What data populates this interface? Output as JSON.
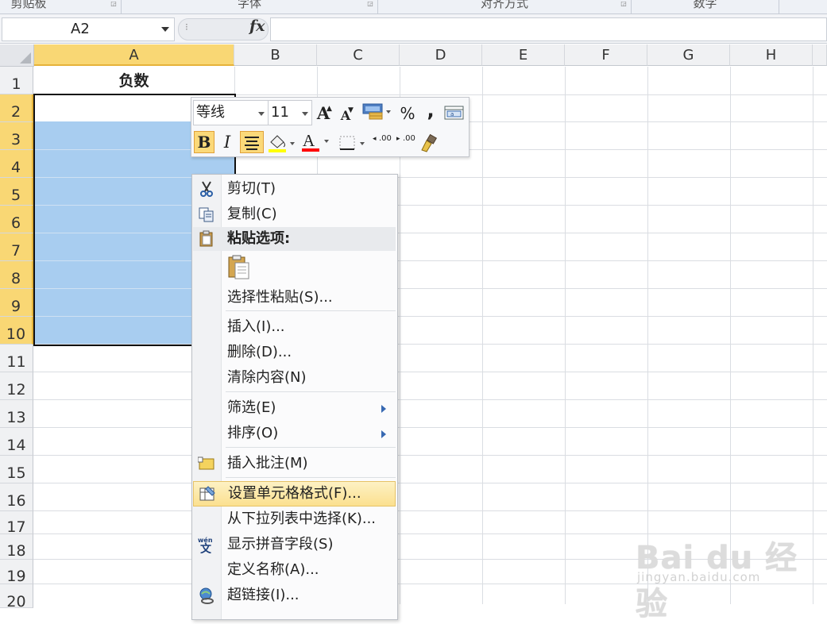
{
  "ribbon": {
    "groups": [
      "剪贴板",
      "字体",
      "对齐方式",
      "数字"
    ]
  },
  "formula_bar": {
    "name_box": "A2",
    "fx_label": "fx",
    "formula": ""
  },
  "grid": {
    "columns": [
      "A",
      "B",
      "C",
      "D",
      "E",
      "F",
      "G",
      "H"
    ],
    "rows": [
      "1",
      "2",
      "3",
      "4",
      "5",
      "6",
      "7",
      "8",
      "9",
      "10",
      "11",
      "12",
      "13",
      "14",
      "15",
      "16",
      "17",
      "18",
      "19",
      "20"
    ],
    "selected_column": "A",
    "selected_rows": [
      "2",
      "3",
      "4",
      "5",
      "6",
      "7",
      "8",
      "9",
      "10"
    ],
    "cells": {
      "A1": "负数"
    },
    "selection_fill_color": "#a8cdf0",
    "header_highlight_color": "#f9d774"
  },
  "mini_toolbar": {
    "font_name": "等线",
    "font_size": "11",
    "grow_font": "A",
    "shrink_font": "A",
    "percent": "%",
    "comma": ",",
    "bold": "B",
    "italic": "I",
    "font_color_letter": "A",
    "increase_decimal": ".00",
    "decrease_decimal": ".00"
  },
  "context_menu": {
    "items": [
      {
        "label": "剪切(T)",
        "icon": "scissors-icon"
      },
      {
        "label": "复制(C)",
        "icon": "copy-icon"
      },
      {
        "label": "粘贴选项:",
        "icon": "paste-icon",
        "header": true
      },
      {
        "label": "",
        "icon": "paste-option-icon"
      },
      {
        "label": "选择性粘贴(S)...",
        "icon": ""
      },
      {
        "label": "插入(I)...",
        "icon": ""
      },
      {
        "label": "删除(D)...",
        "icon": ""
      },
      {
        "label": "清除内容(N)",
        "icon": ""
      },
      {
        "label": "筛选(E)",
        "icon": "",
        "submenu": true
      },
      {
        "label": "排序(O)",
        "icon": "",
        "submenu": true
      },
      {
        "label": "插入批注(M)",
        "icon": "comment-icon"
      },
      {
        "label": "设置单元格格式(F)...",
        "icon": "format-cells-icon",
        "highlighted": true
      },
      {
        "label": "从下拉列表中选择(K)...",
        "icon": ""
      },
      {
        "label": "显示拼音字段(S)",
        "icon": "pinyin-icon"
      },
      {
        "label": "定义名称(A)...",
        "icon": ""
      },
      {
        "label": "超链接(I)...",
        "icon": "hyperlink-icon"
      }
    ],
    "highlight_color": "#fbe08f"
  },
  "watermark": {
    "brand": "Bai du 经验",
    "url": "jingyan.baidu.com"
  }
}
